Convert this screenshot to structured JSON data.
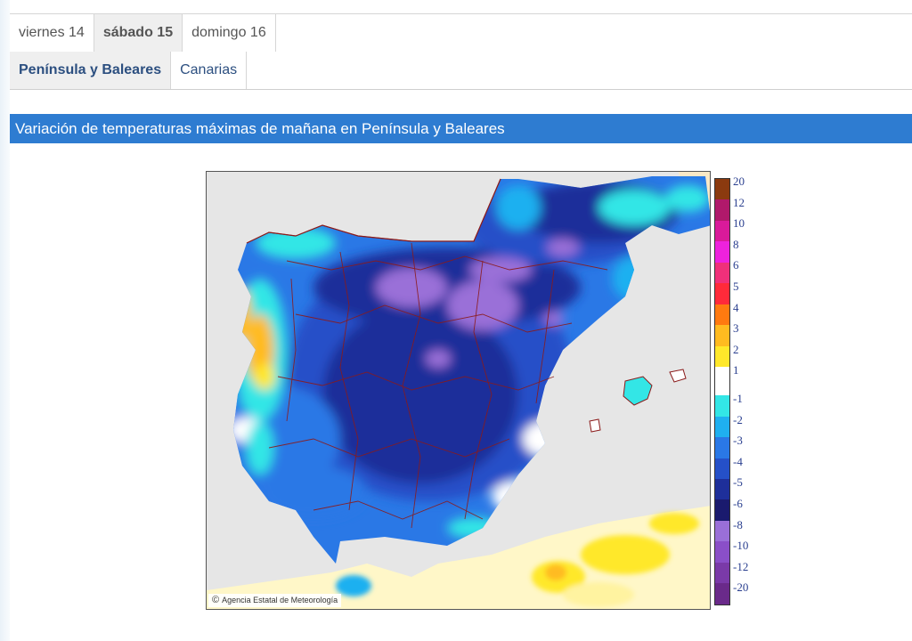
{
  "days": [
    {
      "label": "viernes 14",
      "active": false
    },
    {
      "label": "sábado 15",
      "active": true
    },
    {
      "label": "domingo 16",
      "active": false
    }
  ],
  "regions": [
    {
      "label": "Península y Baleares",
      "active": true
    },
    {
      "label": "Canarias",
      "active": false
    }
  ],
  "map": {
    "title": "Variación de temperaturas máximas de mañana en Península y Baleares",
    "credit": "Agencia Estatal de Meteorología",
    "credit_icon": "copyright-icon"
  },
  "legend": {
    "positive": [
      {
        "label": "20",
        "color": "#8b3a0f"
      },
      {
        "label": "12",
        "color": "#b0196b"
      },
      {
        "label": "10",
        "color": "#d91a9a"
      },
      {
        "label": "8",
        "color": "#ee22dd"
      },
      {
        "label": "6",
        "color": "#f0307a"
      },
      {
        "label": "5",
        "color": "#ff2a3a"
      },
      {
        "label": "4",
        "color": "#ff7a10"
      },
      {
        "label": "3",
        "color": "#ffbb20"
      },
      {
        "label": "2",
        "color": "#ffe82a"
      },
      {
        "label": "1",
        "color": "#ffffff"
      }
    ],
    "negative": [
      {
        "label": "-1",
        "color": "#33e6e6"
      },
      {
        "label": "-2",
        "color": "#1fb0f0"
      },
      {
        "label": "-3",
        "color": "#2a78e6"
      },
      {
        "label": "-4",
        "color": "#2550c8"
      },
      {
        "label": "-5",
        "color": "#1e2f9a"
      },
      {
        "label": "-6",
        "color": "#1a1a6e"
      },
      {
        "label": "-8",
        "color": "#9a6fd8"
      },
      {
        "label": "-10",
        "color": "#8a4fc8"
      },
      {
        "label": "-12",
        "color": "#7a3aa8"
      },
      {
        "label": "-20",
        "color": "#6a2a8a"
      }
    ]
  }
}
